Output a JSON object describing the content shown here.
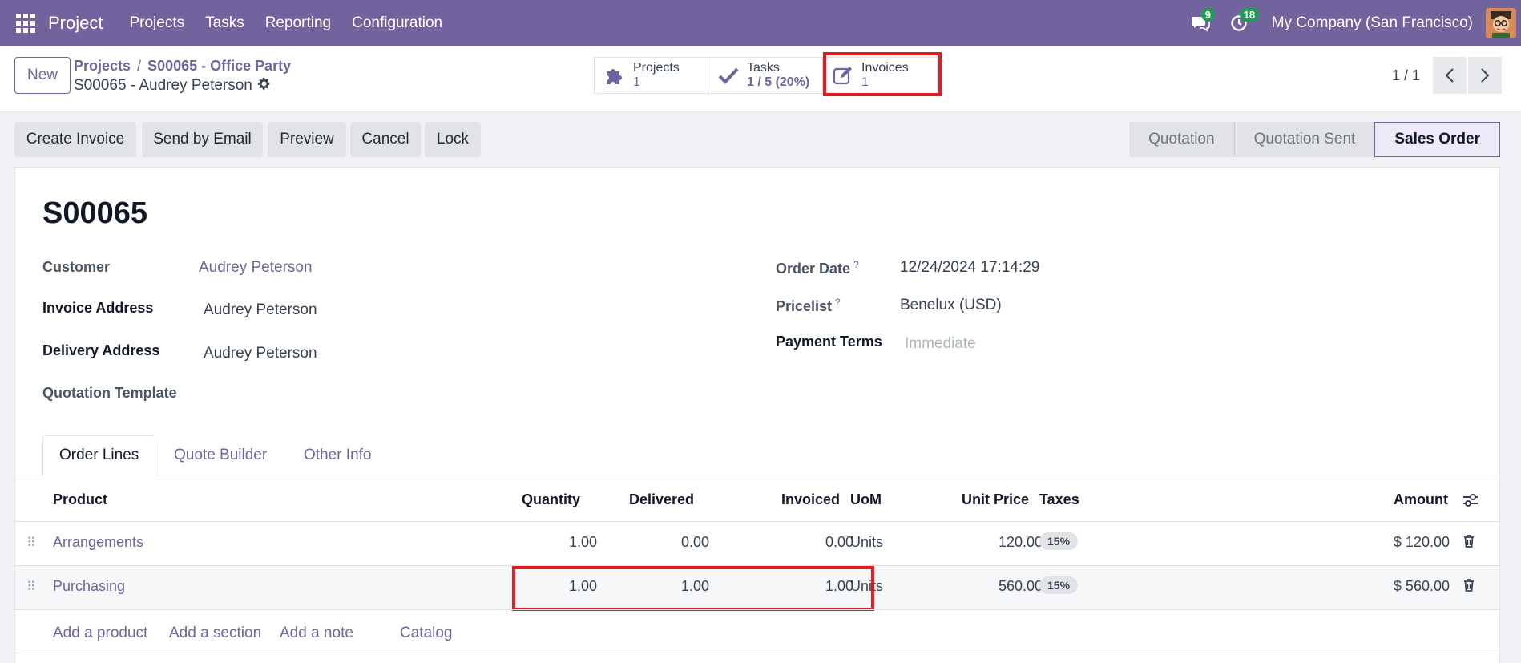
{
  "nav": {
    "app_title": "Project",
    "items": [
      "Projects",
      "Tasks",
      "Reporting",
      "Configuration"
    ],
    "messages_count": "9",
    "activities_count": "18",
    "company": "My Company (San Francisco)"
  },
  "control": {
    "new_label": "New",
    "breadcrumb": [
      "Projects",
      "S00065 - Office Party"
    ],
    "breadcrumb_sep": "/",
    "record_name": "S00065 - Audrey Peterson",
    "smart_buttons": [
      {
        "label": "Projects",
        "value": "1"
      },
      {
        "label": "Tasks",
        "value": "1 / 5 (20%)"
      },
      {
        "label": "Invoices",
        "value": "1"
      }
    ],
    "pager": "1 / 1"
  },
  "actions": [
    "Create Invoice",
    "Send by Email",
    "Preview",
    "Cancel",
    "Lock"
  ],
  "stages": [
    "Quotation",
    "Quotation Sent",
    "Sales Order"
  ],
  "form": {
    "title": "S00065",
    "customer_label": "Customer",
    "customer": "Audrey Peterson",
    "invoice_address_label": "Invoice Address",
    "invoice_address": "Audrey Peterson",
    "delivery_address_label": "Delivery Address",
    "delivery_address": "Audrey Peterson",
    "quotation_template_label": "Quotation Template",
    "order_date_label": "Order Date",
    "order_date": "12/24/2024 17:14:29",
    "pricelist_label": "Pricelist",
    "pricelist": "Benelux (USD)",
    "payment_terms_label": "Payment Terms",
    "payment_terms_placeholder": "Immediate",
    "help_mark": "?"
  },
  "tabs": [
    "Order Lines",
    "Quote Builder",
    "Other Info"
  ],
  "lines": {
    "headers": {
      "product": "Product",
      "quantity": "Quantity",
      "delivered": "Delivered",
      "invoiced": "Invoiced",
      "uom": "UoM",
      "unit_price": "Unit Price",
      "taxes": "Taxes",
      "amount": "Amount"
    },
    "rows": [
      {
        "product": "Arrangements",
        "quantity": "1.00",
        "delivered": "0.00",
        "invoiced": "0.00",
        "uom": "Units",
        "unit_price": "120.00",
        "tax": "15%",
        "amount": "$ 120.00"
      },
      {
        "product": "Purchasing",
        "quantity": "1.00",
        "delivered": "1.00",
        "invoiced": "1.00",
        "uom": "Units",
        "unit_price": "560.00",
        "tax": "15%",
        "amount": "$ 560.00"
      }
    ],
    "add_links": [
      "Add a product",
      "Add a section",
      "Add a note",
      "Catalog"
    ]
  },
  "colors": {
    "brand": "#71639e",
    "highlight": "#e01b24"
  }
}
